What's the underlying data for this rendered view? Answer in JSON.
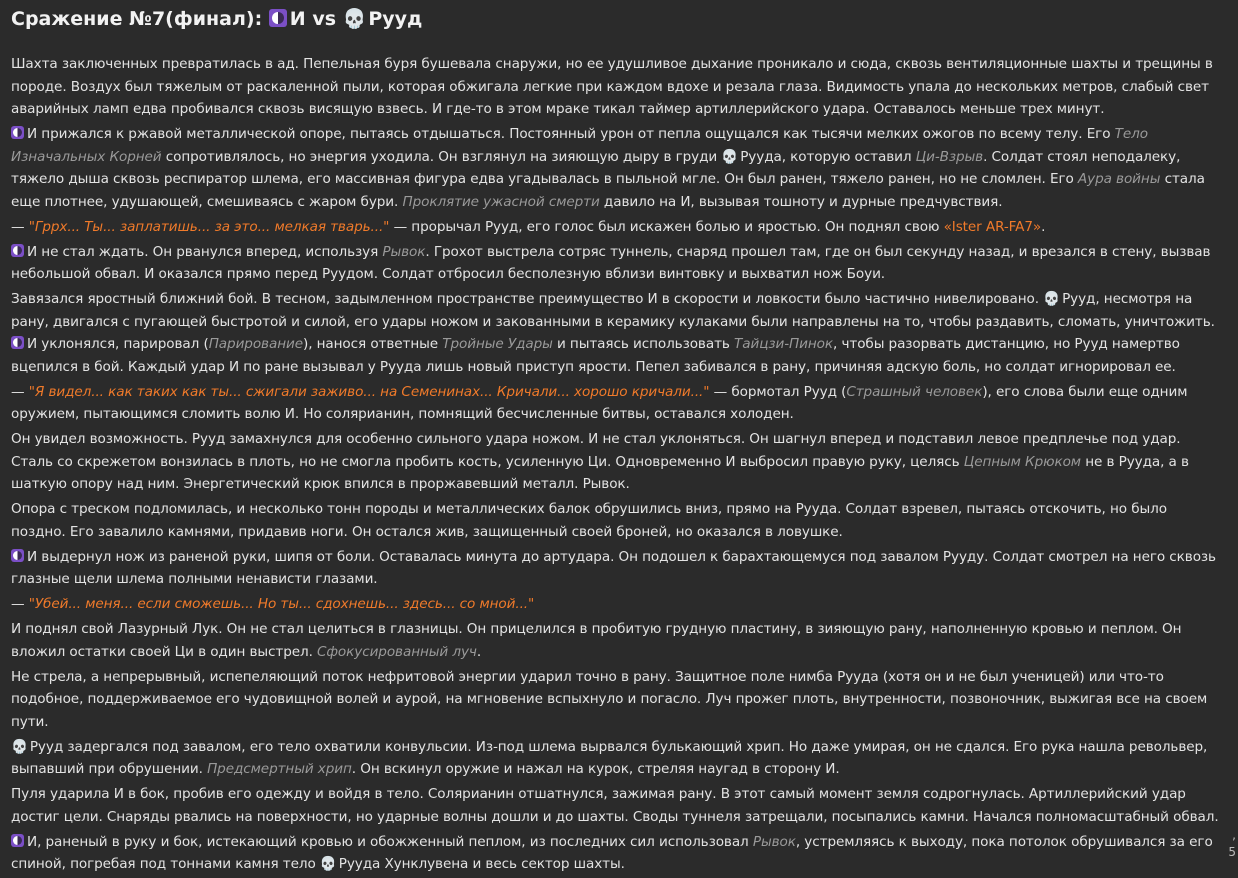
{
  "title": {
    "prefix": "Сражение №7(финал): ",
    "fighter1": "И",
    "vs": " vs ",
    "fighter2": "Рууд"
  },
  "icons": {
    "fighter1": "yin-yang-icon",
    "fighter2": "skull-icon"
  },
  "colors": {
    "background": "#2b2b2b",
    "text": "#e3e3e3",
    "quote": "#f07a2a",
    "skill": "#9a9a9a",
    "icon_purple": "#7b4fc6"
  },
  "p1": "Шахта заключенных превратилась в ад. Пепельная буря бушевала снаружи, но ее удушливое дыхание проникало и сюда, сквозь вентиляционные шахты и трещины в породе. Воздух был тяжелым от раскаленной пыли, которая обжигала легкие при каждом вдохе и резала глаза. Видимость упала до нескольких метров, слабый свет аварийных ламп едва пробивался сквозь висящую взвесь. И где-то в этом мраке тикал таймер артиллерийского удара. Оставалось меньше трех минут.",
  "p2": {
    "a": "И прижался к ржавой металлической опоре, пытаясь отдышаться. Постоянный урон от пепла ощущался как тысячи мелких ожогов по всему телу. Его ",
    "s1": "Тело Изначальных Корней",
    "b": " сопротивлялось, но энергия уходила. Он взглянул на зияющую дыру в груди ",
    "c": "Рууда, которую оставил ",
    "s2": "Ци-Взрыв",
    "d": ". Солдат стоял неподалеку, тяжело дыша сквозь респиратор шлема, его массивная фигура едва угадывалась в пыльной мгле. Он был ранен, тяжело ранен, но не сломлен. Его ",
    "s3": "Аура войны",
    "e": " стала еще плотнее, удушающей, смешиваясь с жаром бури. ",
    "s4": "Проклятие ужасной смерти",
    "f": " давило на И, вызывая тошноту и дурные предчувствия."
  },
  "p3": {
    "dash": "— ",
    "quote": "\"Гррх... Ты... заплатишь... за это... мелкая тварь...\"",
    "a": " — прорычал Рууд, его голос был искажен болью и яростью. Он поднял свою ",
    "weapon": "«Ister AR-FA7»",
    "b": "."
  },
  "p4": {
    "a": "И не стал ждать. Он рванулся вперед, используя ",
    "s1": "Рывок",
    "b": ". Грохот выстрела сотряс туннель, снаряд прошел там, где он был секунду назад, и врезался в стену, вызвав небольшой обвал. И оказался прямо перед Руудом. Солдат отбросил бесполезную вблизи винтовку и выхватил нож Боуи."
  },
  "p5": {
    "a": "Завязался яростный ближний бой. В тесном, задымленном пространстве преимущество И в скорости и ловкости было частично нивелировано. ",
    "b": "Рууд, несмотря на рану, двигался с пугающей быстротой и силой, его удары ножом и закованными в керамику кулаками были направлены на то, чтобы раздавить, сломать, уничтожить. ",
    "c": "И уклонялся, парировал (",
    "s1": "Парирование",
    "d": "), нанося ответные ",
    "s2": "Тройные Удары",
    "e": " и пытаясь использовать ",
    "s3": "Тайцзи-Пинок",
    "f": ", чтобы разорвать дистанцию, но Рууд намертво вцепился в бой. Каждый удар И по ране вызывал у Рууда лишь новый приступ ярости. Пепел забивался в рану, причиняя адскую боль, но солдат игнорировал ее."
  },
  "p6": {
    "dash": "— ",
    "quote": "\"Я видел... как таких как ты... сжигали заживо... на Семенинах... Кричали... хорошо кричали...\"",
    "a": " — бормотал Рууд (",
    "s1": "Страшный человек",
    "b": "), его слова были еще одним оружием, пытающимся сломить волю И. Но солярианин, помнящий бесчисленные битвы, оставался холоден."
  },
  "p7": {
    "a": "Он увидел возможность. Рууд замахнулся для особенно сильного удара ножом. И не стал уклоняться. Он шагнул вперед и подставил левое предплечье под удар. Сталь со скрежетом вонзилась в плоть, но не смогла пробить кость, усиленную Ци. Одновременно И выбросил правую руку, целясь ",
    "s1": "Цепным Крюком",
    "b": " не в Рууда, а в шаткую опору над ним. Энергетический крюк впился в проржавевший металл. Рывок."
  },
  "p8": "Опора с треском подломилась, и несколько тонн породы и металлических балок обрушились вниз, прямо на Рууда. Солдат взревел, пытаясь отскочить, но было поздно. Его завалило камнями, придавив ноги. Он остался жив, защищенный своей броней, но оказался в ловушке.",
  "p9": "И выдернул нож из раненой руки, шипя от боли. Оставалась минута до артудара. Он подошел к барахтающемуся под завалом Рууду. Солдат смотрел на него сквозь глазные щели шлема полными ненависти глазами.",
  "p10": {
    "dash": "— ",
    "quote": "\"Убей... меня... если сможешь... Но ты... сдохнешь... здесь... со мной...\""
  },
  "p11": {
    "a": "И поднял свой Лазурный Лук. Он не стал целиться в глазницы. Он прицелился в пробитую грудную пластину, в зияющую рану, наполненную кровью и пеплом. Он вложил остатки своей Ци в один выстрел. ",
    "s1": "Сфокусированный луч",
    "b": "."
  },
  "p12": "Не стрела, а непрерывный, испепеляющий поток нефритовой энергии ударил точно в рану. Защитное поле нимба Рууда (хотя он и не был ученицей) или что-то подобное, поддерживаемое его чудовищной волей и аурой, на мгновение вспыхнуло и погасло. Луч прожег плоть, внутренности, позвоночник, выжигая все на своем пути.",
  "p13": {
    "a": "Рууд задергался под завалом, его тело охватили конвульсии. Из-под шлема вырвался булькающий хрип. Но даже умирая, он не сдался. Его рука нашла револьвер, выпавший при обрушении. ",
    "s1": "Предсмертный хрип",
    "b": ". Он вскинул оружие и нажал на курок, стреляя наугад в сторону И."
  },
  "p14": "Пуля ударила И в бок, пробив его одежду и войдя в тело. Солярианин отшатнулся, зажимая рану. В этот самый момент земля содрогнулась. Артиллерийский удар достиг цели. Снаряды рвались на поверхности, но ударные волны дошли и до шахты. Своды туннеля затрещали, посыпались камни. Начался полномасштабный обвал.",
  "p15": {
    "a": "И, раненый в руку и бок, истекающий кровью и обожженный пеплом, из последних сил использовал ",
    "s1": "Рывок",
    "b": ", устремляясь к выходу, пока потолок обрушивался за его спиной, погребая под тоннами камня тело ",
    "c": "Рууда Хунклувена и весь сектор шахты."
  },
  "edge": {
    "m1": ",",
    "m2": "5"
  }
}
